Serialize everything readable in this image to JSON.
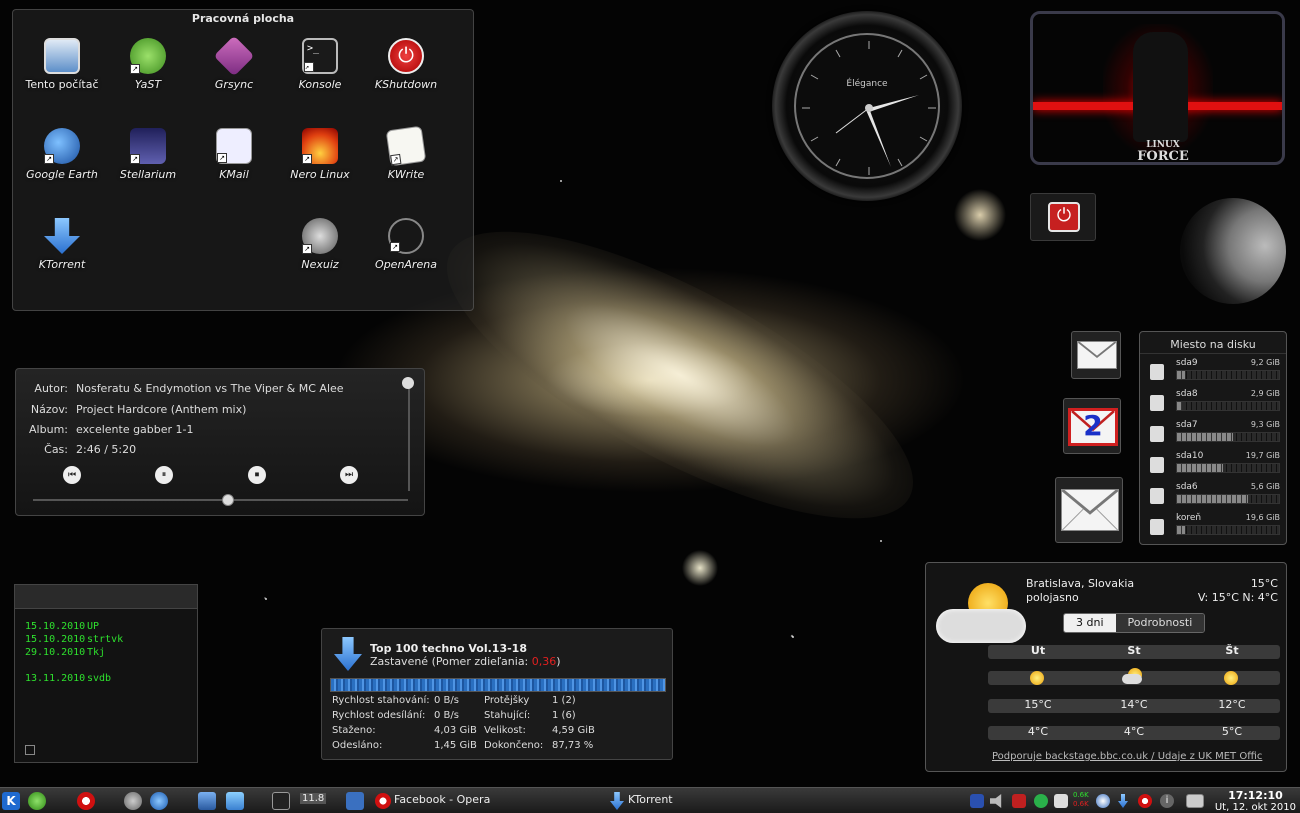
{
  "folder": {
    "title": "Pracovná plocha",
    "icons": [
      {
        "label": "Tento počítač"
      },
      {
        "label": "YaST"
      },
      {
        "label": "Grsync"
      },
      {
        "label": "Konsole"
      },
      {
        "label": "KShutdown"
      },
      {
        "label": "Google Earth"
      },
      {
        "label": "Stellarium"
      },
      {
        "label": "KMail"
      },
      {
        "label": "Nero Linux"
      },
      {
        "label": "KWrite"
      },
      {
        "label": "KTorrent"
      },
      {
        "label": "Nexuiz"
      },
      {
        "label": "OpenArena"
      }
    ]
  },
  "clock": {
    "brand": "Élégance"
  },
  "linuxforce": {
    "text_top": "LINUX",
    "text_bottom": "FORCE"
  },
  "mail": {
    "unread_count": "2"
  },
  "disk": {
    "title": "Miesto na disku",
    "drives": [
      {
        "name": "sda9",
        "size": "9,2 GiB",
        "used_fraction": 0.08
      },
      {
        "name": "sda8",
        "size": "2,9 GiB",
        "used_fraction": 0.05
      },
      {
        "name": "sda7",
        "size": "9,3 GiB",
        "used_fraction": 0.55
      },
      {
        "name": "sda10",
        "size": "19,7 GiB",
        "used_fraction": 0.45
      },
      {
        "name": "sda6",
        "size": "5,6 GiB",
        "used_fraction": 0.7
      },
      {
        "name": "koreň",
        "size": "19,6 GiB",
        "used_fraction": 0.08
      }
    ]
  },
  "player": {
    "artist_label": "Autor:",
    "artist": "Nosferatu & Endymotion vs The Viper & MC Alee",
    "title_label": "Názov:",
    "title": "Project Hardcore (Anthem mix)",
    "album_label": "Album:",
    "album": "excelente gabber 1-1",
    "time_label": "Čas:",
    "time": "2:46 / 5:20",
    "progress_fraction": 0.52
  },
  "notes": {
    "lines": [
      {
        "date": "15.10.2010",
        "text": "UP"
      },
      {
        "date": "15.10.2010",
        "text": "strtvk"
      },
      {
        "date": "29.10.2010",
        "text": "Tkj"
      },
      {
        "date": "13.11.2010",
        "text": "svdb"
      }
    ]
  },
  "torrent": {
    "title": "Top 100 techno Vol.13-18",
    "status": "Zastavené (Pomer zdieľania: ",
    "ratio": "0,36",
    "status_close": ")",
    "rows": [
      {
        "k1": "Rychlost stahování:",
        "v1": "0 B/s",
        "k2": "Protějšky",
        "v2": "1 (2)"
      },
      {
        "k1": "Rychlost odesílání:",
        "v1": "0 B/s",
        "k2": "Stahující:",
        "v2": "1 (6)"
      },
      {
        "k1": "Staženo:",
        "v1": "4,03 GiB",
        "k2": "Velikost:",
        "v2": "4,59 GiB"
      },
      {
        "k1": "Odesláno:",
        "v1": "1,45 GiB",
        "k2": "Dokončeno:",
        "v2": "87,73 %"
      }
    ]
  },
  "weather": {
    "city": "Bratislava, Slovakia",
    "condition": "polojasno",
    "temp": "15°C",
    "range": "V: 15°C N: 4°C",
    "tab_3days": "3 dni",
    "tab_details": "Podrobnosti",
    "days": [
      {
        "name": "Ut",
        "high": "15°C",
        "low": "4°C",
        "icon": "sun"
      },
      {
        "name": "St",
        "high": "14°C",
        "low": "4°C",
        "icon": "sun-cloud"
      },
      {
        "name": "Št",
        "high": "12°C",
        "low": "5°C",
        "icon": "sun"
      }
    ],
    "credit": "Podporuje backstage.bbc.co.uk / Údaje z UK MET Offic"
  },
  "taskbar": {
    "desktop_num": "11.8",
    "task_opera": "Facebook - Opera",
    "task_ktorrent": "KTorrent",
    "net_up": "0.6K",
    "net_down": "0.6K",
    "time": "17:12:10",
    "date": "Ut, 12. okt 2010"
  },
  "colors": {
    "accent_red": "#e02020",
    "note_green": "#2ee02e",
    "torrent_blue": "#2a6fc0"
  }
}
